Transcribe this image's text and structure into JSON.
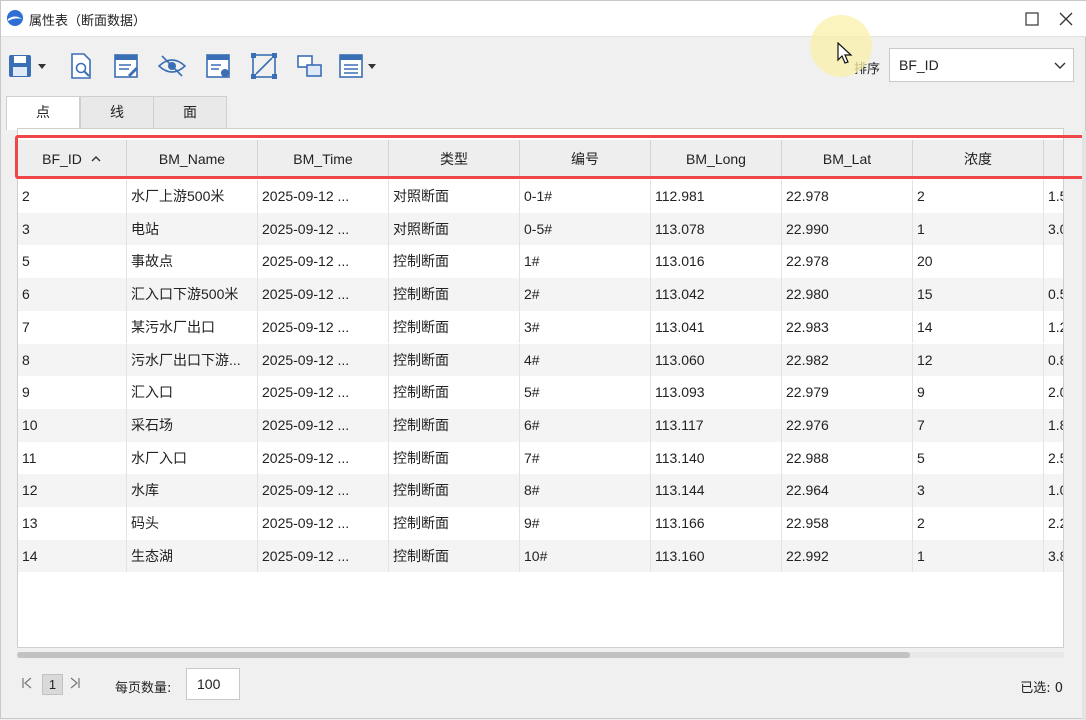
{
  "window": {
    "title": "属性表（断面数据）"
  },
  "toolbar": {
    "icons": [
      "save-icon",
      "dropdown-arrow-icon",
      "search-document-icon",
      "edit-document-icon",
      "visibility-icon",
      "locate-icon",
      "bounding-box-icon",
      "layers-icon",
      "list-menu-icon"
    ],
    "sort_label": "排序",
    "sort_value": "BF_ID"
  },
  "tabs": [
    {
      "label": "点",
      "active": true
    },
    {
      "label": "线",
      "active": false
    },
    {
      "label": "面",
      "active": false
    }
  ],
  "table": {
    "columns": [
      "BF_ID",
      "BM_Name",
      "BM_Time",
      "类型",
      "编号",
      "BM_Long",
      "BM_Lat",
      "浓度",
      ""
    ],
    "sorted_column": "BF_ID",
    "sort_direction": "ascending",
    "rows": [
      [
        "2",
        "水厂上游500米",
        "2025-09-12 ...",
        "对照断面",
        "0-1#",
        "112.981",
        "22.978",
        "2",
        "1.5"
      ],
      [
        "3",
        "电站",
        "2025-09-12 ...",
        "对照断面",
        "0-5#",
        "113.078",
        "22.990",
        "1",
        "3.0"
      ],
      [
        "5",
        "事故点",
        "2025-09-12 ...",
        "控制断面",
        "1#",
        "113.016",
        "22.978",
        "20",
        ""
      ],
      [
        "6",
        "汇入口下游500米",
        "2025-09-12 ...",
        "控制断面",
        "2#",
        "113.042",
        "22.980",
        "15",
        "0.5"
      ],
      [
        "7",
        "某污水厂出口",
        "2025-09-12 ...",
        "控制断面",
        "3#",
        "113.041",
        "22.983",
        "14",
        "1.2"
      ],
      [
        "8",
        "污水厂出口下游...",
        "2025-09-12 ...",
        "控制断面",
        "4#",
        "113.060",
        "22.982",
        "12",
        "0.8"
      ],
      [
        "9",
        "汇入口",
        "2025-09-12 ...",
        "控制断面",
        "5#",
        "113.093",
        "22.979",
        "9",
        "2.0"
      ],
      [
        "10",
        "采石场",
        "2025-09-12 ...",
        "控制断面",
        "6#",
        "113.117",
        "22.976",
        "7",
        "1.8"
      ],
      [
        "11",
        "水厂入口",
        "2025-09-12 ...",
        "控制断面",
        "7#",
        "113.140",
        "22.988",
        "5",
        "2.5"
      ],
      [
        "12",
        "水库",
        "2025-09-12 ...",
        "控制断面",
        "8#",
        "113.144",
        "22.964",
        "3",
        "1.0"
      ],
      [
        "13",
        "码头",
        "2025-09-12 ...",
        "控制断面",
        "9#",
        "113.166",
        "22.958",
        "2",
        "2.2"
      ],
      [
        "14",
        "生态湖",
        "2025-09-12 ...",
        "控制断面",
        "10#",
        "113.160",
        "22.992",
        "1",
        "3.8"
      ]
    ]
  },
  "pager": {
    "current_page": "1",
    "page_size_label": "每页数量:",
    "page_size": "100",
    "selected_text": "已选: 0"
  },
  "colors": {
    "highlight": "#ef4747",
    "header_bg": "#eeeeee",
    "alt_row_bg": "#f4f4f4",
    "icon_blue": "#3b6fb5"
  }
}
